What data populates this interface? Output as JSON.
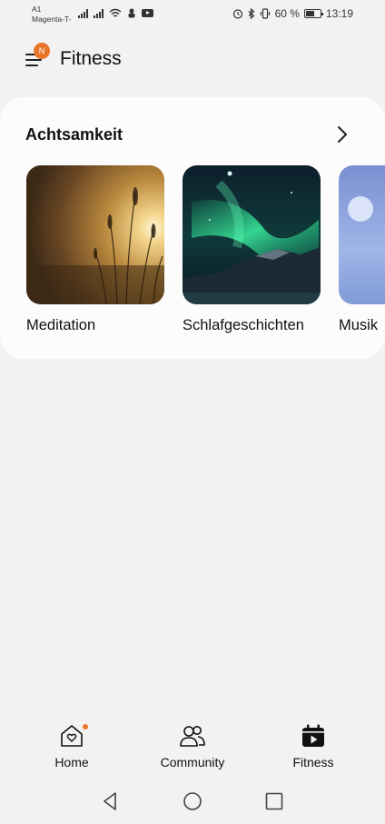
{
  "status_bar": {
    "carrier_line1": "A1",
    "carrier_line2": "Magenta-T-",
    "battery_percent": "60 %",
    "battery_level": 0.6,
    "time": "13:19"
  },
  "header": {
    "menu_badge": "N",
    "title": "Fitness"
  },
  "section": {
    "title": "Achtsamkeit",
    "items": [
      {
        "label": "Meditation",
        "image": "sunset-grass-photo"
      },
      {
        "label": "Schlafgeschichten",
        "image": "aurora-mountain-photo"
      },
      {
        "label": "Musik",
        "image": "blue-sky-photo"
      }
    ]
  },
  "bottom_nav": {
    "items": [
      {
        "label": "Home",
        "icon": "home-heart-icon",
        "has_dot": true
      },
      {
        "label": "Community",
        "icon": "people-icon",
        "has_dot": false
      },
      {
        "label": "Fitness",
        "icon": "calendar-play-icon",
        "active": true
      }
    ]
  },
  "colors": {
    "background": "#f2f2f2",
    "card": "#fcfcfc",
    "accent": "#e8742a"
  }
}
